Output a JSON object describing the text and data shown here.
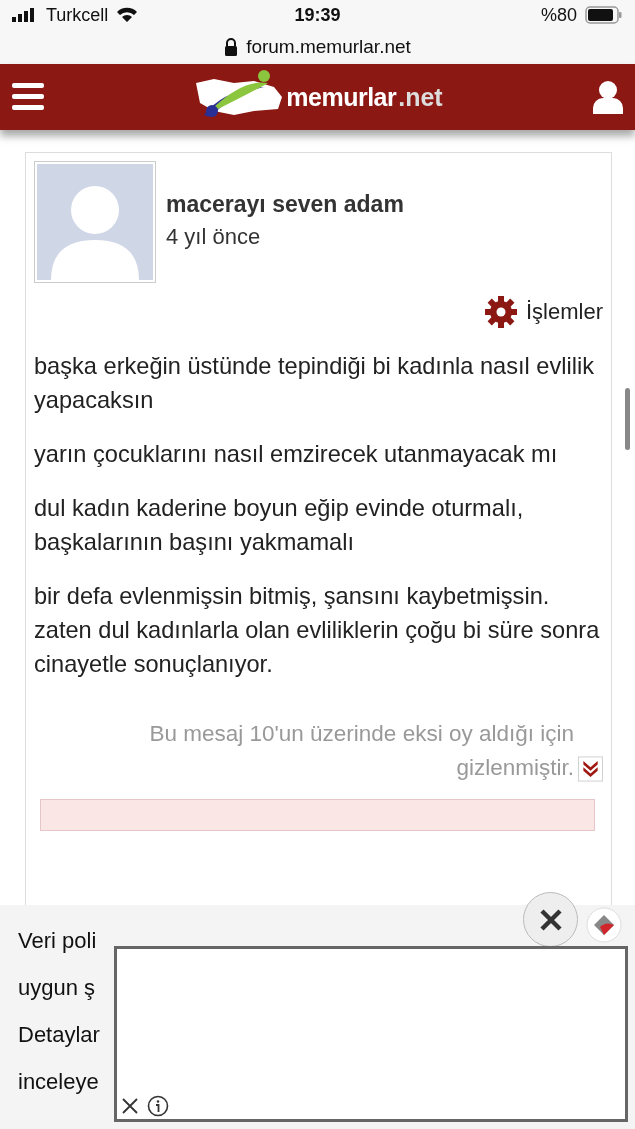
{
  "status_bar": {
    "carrier": "Turkcell",
    "time": "19:39",
    "battery": "%80"
  },
  "address_bar": {
    "url": "forum.memurlar.net"
  },
  "header": {
    "logo_text": "memurlar",
    "logo_suffix": ".net"
  },
  "post": {
    "author": "macerayı seven adam",
    "time": "4 yıl önce",
    "actions": "İşlemler",
    "paragraphs": [
      "başka erkeğin üstünde tepindiği bi kadınla nasıl evlilik yapacaksın",
      "yarın çocuklarını nasıl emzirecek utanmayacak mı",
      "dul kadın kaderine boyun eğip evinde oturmalı, başkalarının başını yakmamalı",
      "bir defa evlenmişsin bitmiş, şansını kaybetmişsin. zaten dul kadınlarla olan evliliklerin çoğu bi süre sonra cinayetle sonuçlanıyor."
    ],
    "hidden_note": "Bu mesaj 10'un üzerinde eksi oy aldığı için gizlenmiştir."
  },
  "consent_banner": {
    "lines": [
      "Veri poli",
      "uygun ş",
      "Detaylar",
      "inceleye"
    ]
  }
}
